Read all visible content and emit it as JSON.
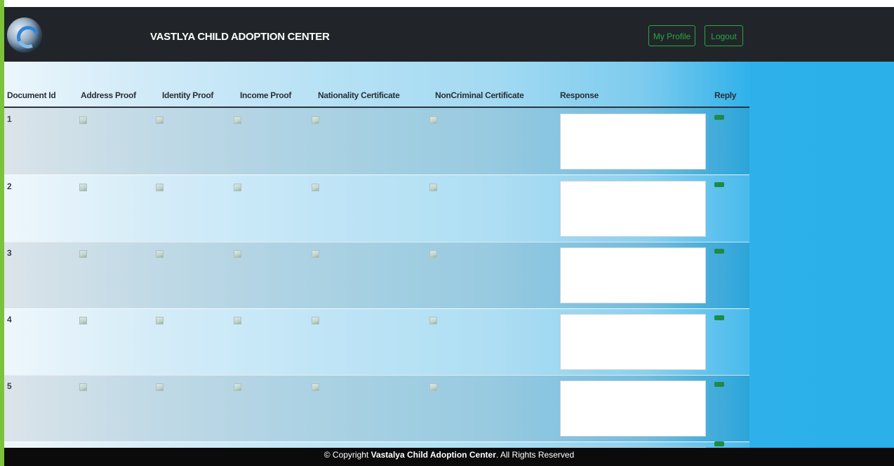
{
  "header": {
    "title": "VASTLYA CHILD ADOPTION CENTER",
    "my_profile_label": "My Profile",
    "logout_label": "Logout",
    "logo_icon": "globe-logo-icon"
  },
  "table": {
    "columns": [
      "Document Id",
      "Address Proof",
      "Identity Proof",
      "Income Proof",
      "Nationality Certificate",
      "NonCriminal Certificate",
      "Response",
      "Reply"
    ],
    "rows": [
      {
        "id": "1",
        "response": ""
      },
      {
        "id": "2",
        "response": ""
      },
      {
        "id": "3",
        "response": ""
      },
      {
        "id": "4",
        "response": ""
      },
      {
        "id": "5",
        "response": ""
      }
    ],
    "image_icon": "broken-image-icon"
  },
  "footer": {
    "prefix": "© Copyright ",
    "org": "Vastalya Child Adoption Center",
    "suffix": ". All Rights Reserved"
  },
  "colors": {
    "navbar": "#212529",
    "accent_green": "#28a745",
    "content_blue": "#2bb0ea",
    "footer": "#0b0b0b",
    "left_border": "#7cc23a"
  }
}
